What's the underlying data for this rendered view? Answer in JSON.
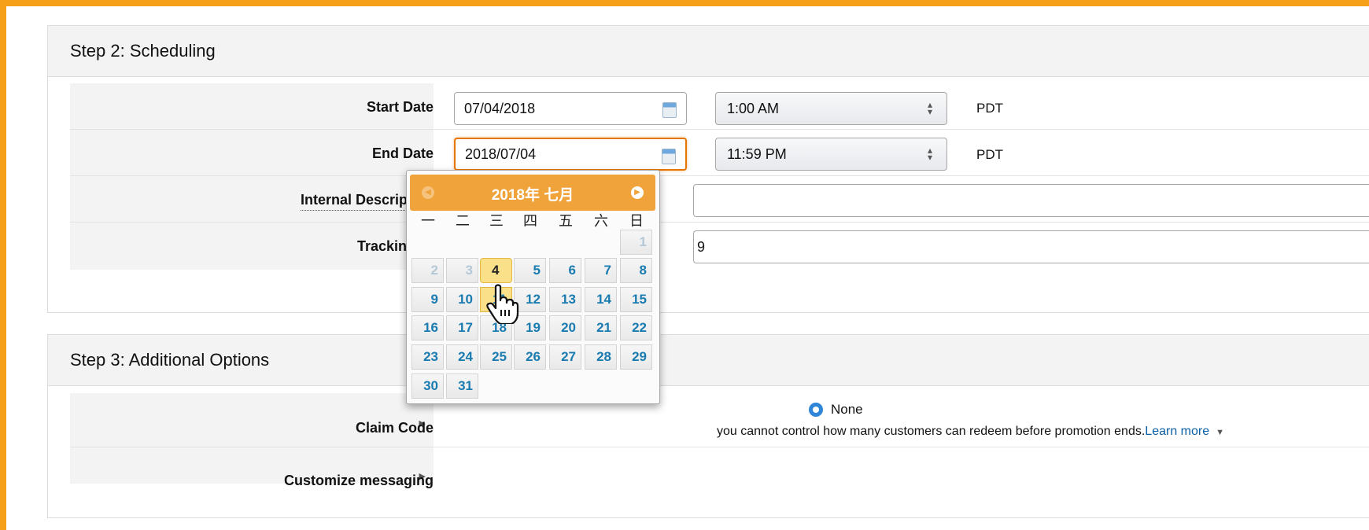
{
  "scheduling": {
    "title": "Step 2: Scheduling",
    "start_date": {
      "label": "Start Date",
      "value": "07/04/2018",
      "time": "1:00 AM",
      "tz": "PDT"
    },
    "end_date": {
      "label": "End Date",
      "value": "2018/07/04",
      "time": "11:59 PM",
      "tz": "PDT"
    },
    "internal_description": {
      "label": "Internal Description",
      "value": ""
    },
    "tracking_id": {
      "label": "Tracking ID",
      "value": "9"
    }
  },
  "datepicker": {
    "title": "2018年 七月",
    "weekdays": [
      "一",
      "二",
      "三",
      "四",
      "五",
      "六",
      "日"
    ],
    "selected_day": 4,
    "hover_day": 11,
    "weeks": [
      [
        null,
        null,
        null,
        null,
        null,
        null,
        1
      ],
      [
        2,
        3,
        4,
        5,
        6,
        7,
        8
      ],
      [
        9,
        10,
        11,
        12,
        13,
        14,
        15
      ],
      [
        16,
        17,
        18,
        19,
        20,
        21,
        22
      ],
      [
        23,
        24,
        25,
        26,
        27,
        28,
        29
      ],
      [
        30,
        31,
        null,
        null,
        null,
        null,
        null
      ]
    ],
    "muted_days": [
      1,
      2,
      3
    ]
  },
  "additional": {
    "title": "Step 3: Additional Options",
    "claim_code": {
      "label": "Claim Code",
      "option": "None",
      "note": "you cannot control how many customers can redeem before promotion ends.",
      "learn_more": "Learn more"
    },
    "customize_messaging": {
      "label": "Customize messaging"
    }
  },
  "colors": {
    "frame": "#f6a01a",
    "link": "#0b5fa5",
    "calendar_header": "#f0a33a",
    "selected_day": "#fbe08a"
  }
}
